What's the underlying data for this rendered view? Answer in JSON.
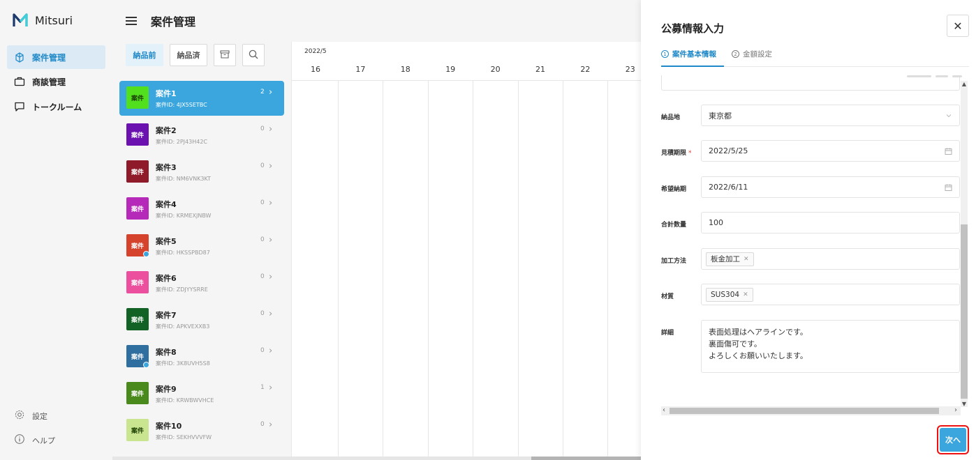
{
  "app": {
    "brand": "Mitsuri"
  },
  "sidebar": {
    "items": [
      {
        "label": "案件管理",
        "icon": "project-icon",
        "active": true
      },
      {
        "label": "商談管理",
        "icon": "briefcase-icon",
        "active": false
      },
      {
        "label": "トークルーム",
        "icon": "chat-icon",
        "active": false
      }
    ],
    "bottom": [
      {
        "label": "設定",
        "icon": "gear-icon"
      },
      {
        "label": "ヘルプ",
        "icon": "info-icon"
      }
    ]
  },
  "header": {
    "title": "案件管理"
  },
  "toolbar": {
    "before_label": "納品前",
    "after_label": "納品済"
  },
  "projects": [
    {
      "badge": "案件",
      "name": "案件1",
      "id": "案件ID: 4JX5SETBC",
      "count": "2",
      "color": "#52e01e",
      "dot": false,
      "selected": true
    },
    {
      "badge": "案件",
      "name": "案件2",
      "id": "案件ID: 2PJ43H42C",
      "count": "0",
      "color": "#6a11b0",
      "dot": false,
      "selected": false
    },
    {
      "badge": "案件",
      "name": "案件3",
      "id": "案件ID: NM6VNK3KT",
      "count": "0",
      "color": "#8f1b2a",
      "dot": false,
      "selected": false
    },
    {
      "badge": "案件",
      "name": "案件4",
      "id": "案件ID: KRMEXJNBW",
      "count": "0",
      "color": "#b52ab8",
      "dot": false,
      "selected": false
    },
    {
      "badge": "案件",
      "name": "案件5",
      "id": "案件ID: HKSSPBD87",
      "count": "0",
      "color": "#d6432c",
      "dot": true,
      "selected": false
    },
    {
      "badge": "案件",
      "name": "案件6",
      "id": "案件ID: ZDJYYSRRE",
      "count": "0",
      "color": "#ec4f9e",
      "dot": false,
      "selected": false
    },
    {
      "badge": "案件",
      "name": "案件7",
      "id": "案件ID: APKVEXXB3",
      "count": "0",
      "color": "#116224",
      "dot": false,
      "selected": false
    },
    {
      "badge": "案件",
      "name": "案件8",
      "id": "案件ID: 3K8UVH5S8",
      "count": "0",
      "color": "#2e6fa0",
      "dot": true,
      "selected": false
    },
    {
      "badge": "案件",
      "name": "案件9",
      "id": "案件ID: KRWBWVHCE",
      "count": "1",
      "color": "#4a8a1d",
      "dot": false,
      "selected": false
    },
    {
      "badge": "案件",
      "name": "案件10",
      "id": "案件ID: SEKHVVVFW",
      "count": "0",
      "color": "#c9e58f",
      "dot": false,
      "selected": false
    }
  ],
  "calendar": {
    "month": "2022/5",
    "days": [
      "16",
      "17",
      "18",
      "19",
      "20",
      "21",
      "22",
      "23"
    ]
  },
  "drawer": {
    "title": "公募情報入力",
    "close": "✕",
    "steps": [
      {
        "num": "1",
        "label": "案件基本情報"
      },
      {
        "num": "2",
        "label": "金額設定"
      }
    ],
    "fields": {
      "delivery_place": {
        "label": "納品地",
        "value": "東京都"
      },
      "quote_deadline": {
        "label": "見積期限",
        "value": "2022/5/25",
        "required": "*"
      },
      "desired_delivery": {
        "label": "希望納期",
        "value": "2022/6/11"
      },
      "total_qty": {
        "label": "合計数量",
        "value": "100"
      },
      "process": {
        "label": "加工方法",
        "tag": "板金加工"
      },
      "material": {
        "label": "材質",
        "tag": "SUS304"
      },
      "details": {
        "label": "詳細",
        "lines": [
          "表面処理はヘアラインです。",
          "裏面傷可です。",
          "よろしくお願いいたします。"
        ]
      }
    },
    "next_label": "次へ"
  }
}
